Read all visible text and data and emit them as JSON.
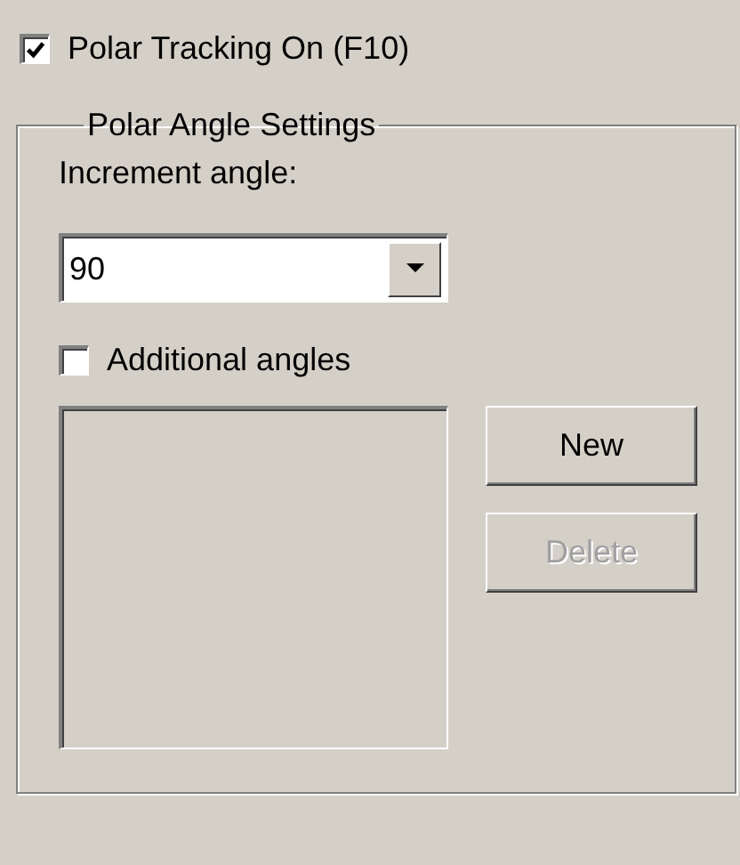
{
  "polar_tracking": {
    "label": "Polar Tracking On (F10)",
    "checked": true
  },
  "polar_angle_settings": {
    "title": "Polar Angle Settings",
    "increment_angle": {
      "label": "Increment angle:",
      "value": "90"
    },
    "additional_angles": {
      "label": "Additional angles",
      "checked": false
    },
    "angles_list": {
      "disabled": true
    },
    "buttons": [
      {
        "label": "New",
        "disabled": false
      },
      {
        "label": "Delete",
        "disabled": true
      }
    ]
  }
}
